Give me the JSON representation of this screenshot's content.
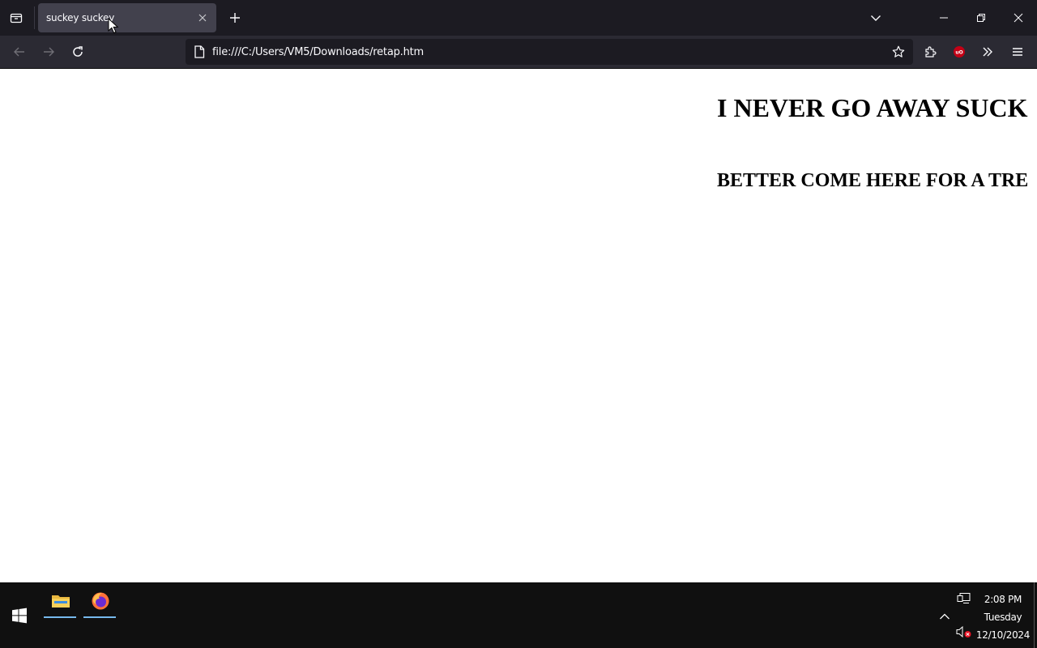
{
  "browser": {
    "tab": {
      "title": "suckey suckey"
    },
    "url": "file:///C:/Users/VM5/Downloads/retap.htm"
  },
  "page": {
    "heading1": "I NEVER GO AWAY SUCK",
    "heading2": "BETTER COME HERE FOR A TRE"
  },
  "taskbar": {
    "apps": [
      "file-explorer",
      "firefox"
    ],
    "clock": {
      "time": "2:08 PM",
      "day": "Tuesday",
      "date": "12/10/2024"
    }
  },
  "colors": {
    "tab_strip": "#1c1b22",
    "toolbar": "#2b2a33",
    "active_tab": "#42414d",
    "taskbar": "#101010",
    "taskbar_indicator": "#76b9ed"
  }
}
